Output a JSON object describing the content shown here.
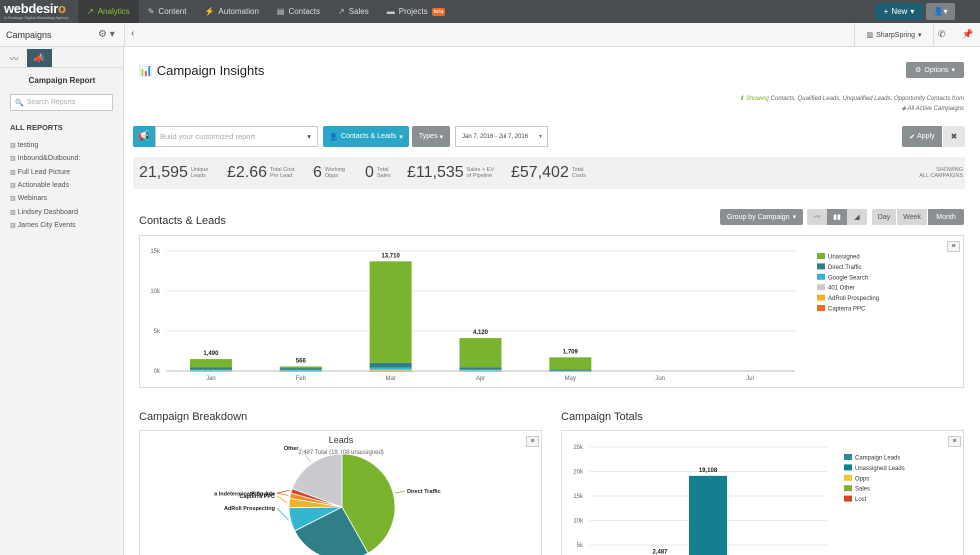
{
  "brand": {
    "name_a": "webdesir",
    "name_b": "o",
    "tagline": "A Strategic Digital Marketing Agency"
  },
  "nav": [
    {
      "label": "Analytics",
      "icon": "chart-line-icon",
      "glyph": "↗",
      "active": true
    },
    {
      "label": "Content",
      "icon": "pencil-icon",
      "glyph": "✎",
      "active": false
    },
    {
      "label": "Automation",
      "icon": "wand-icon",
      "glyph": "⚡",
      "active": false
    },
    {
      "label": "Contacts",
      "icon": "contacts-icon",
      "glyph": "▤",
      "active": false
    },
    {
      "label": "Sales",
      "icon": "sales-icon",
      "glyph": "↗",
      "active": false
    },
    {
      "label": "Projects",
      "icon": "folder-icon",
      "glyph": "▬",
      "active": false,
      "badge": "beta"
    }
  ],
  "top_right": {
    "new_label": "New",
    "user_icon": "user-icon"
  },
  "subbar": {
    "campaigns": "Campaigns",
    "account": "SharpSpring"
  },
  "sidebar": {
    "title": "Campaign Report",
    "search_placeholder": "Search Reports",
    "section": "ALL REPORTS",
    "items": [
      "testing",
      "Inbound&Outbound:",
      "Full Lead Picture",
      "Actionable leads",
      "Webinars",
      "Lindsey Dashboard",
      "James City Events"
    ]
  },
  "header": {
    "title": "Campaign Insights",
    "options_label": "Options",
    "showing_prefix": "Showing",
    "showing_text": "Contacts, Qualified Leads, Unqualified Leads, Opportunity Contacts from",
    "showing_scope": "All Active Campaigns"
  },
  "toolbar": {
    "report_placeholder": "Build your customized report",
    "contacts_label": "Contacts & Leads",
    "types_label": "Types",
    "date_range": "Jan 7, 2016 - Jul 7, 2016",
    "apply_label": "Apply"
  },
  "stats": [
    {
      "value": "21,595",
      "label1": "Unique",
      "label2": "Leads"
    },
    {
      "value": "£2.66",
      "label1": "Total Cost",
      "label2": "Per Lead"
    },
    {
      "value": "6",
      "label1": "Working",
      "label2": "Opps"
    },
    {
      "value": "0",
      "label1": "Total",
      "label2": "Sales"
    },
    {
      "value": "£11,535",
      "label1": "Sales + EV",
      "label2": "of Pipeline"
    },
    {
      "value": "£57,402",
      "label1": "Total",
      "label2": "Costs"
    }
  ],
  "stats_showing": {
    "line1": "SHOWING",
    "line2": "ALL CAMPAIGNS"
  },
  "contacts_section": {
    "title": "Contacts & Leads",
    "group_label": "Group by Campaign",
    "periods": [
      "Day",
      "Week",
      "Month"
    ],
    "active_period": "Month"
  },
  "breakdown_title": "Campaign Breakdown",
  "totals_title": "Campaign Totals",
  "colors": {
    "unassigned": "#7ab32e",
    "direct": "#2e7f87",
    "google": "#35b6d0",
    "other401": "#c9cbce",
    "adroll": "#f0b323",
    "capterra": "#ee6c23",
    "bing": "#d9452b",
    "indeterminate": "#f08b2a",
    "campaign_leads": "#2f8a8a",
    "unassigned_leads": "#14808f",
    "opps": "#f0c431",
    "sales": "#7ab32e",
    "lost": "#d9452b"
  },
  "chart_data": [
    {
      "type": "bar",
      "stacked": true,
      "categories": [
        "Jan",
        "Feb",
        "Mar",
        "Apr",
        "May",
        "Jun",
        "Jul"
      ],
      "totals": [
        1490,
        566,
        13710,
        4120,
        1709,
        null,
        null
      ],
      "total_labels": [
        "1,490",
        "566",
        "13,710",
        "4,120",
        "1,709",
        "",
        ""
      ],
      "series": [
        {
          "name": "Unassigned",
          "color": "#7ab32e",
          "values": [
            1050,
            200,
            12700,
            3650,
            1500,
            0,
            0
          ]
        },
        {
          "name": "Direct Traffic",
          "color": "#2e7f87",
          "values": [
            280,
            220,
            600,
            300,
            140,
            0,
            0
          ]
        },
        {
          "name": "Google Search",
          "color": "#35b6d0",
          "values": [
            80,
            80,
            250,
            90,
            40,
            0,
            0
          ]
        },
        {
          "name": "401 Other",
          "color": "#c9cbce",
          "values": [
            50,
            50,
            120,
            50,
            20,
            0,
            0
          ]
        },
        {
          "name": "AdRoll Prospecting",
          "color": "#f0b323",
          "values": [
            20,
            10,
            30,
            20,
            5,
            0,
            0
          ]
        },
        {
          "name": "Capterra PPC",
          "color": "#ee6c23",
          "values": [
            10,
            6,
            10,
            10,
            4,
            0,
            0
          ]
        }
      ],
      "y_ticks": [
        "0k",
        "5k",
        "10k",
        "15k"
      ],
      "ylim": [
        0,
        15000
      ],
      "legend": "right"
    },
    {
      "type": "pie",
      "title": "Leads",
      "subtitle": "2,487 Total (19,108 unassigned)",
      "slices": [
        {
          "name": "Direct Traffic",
          "value": 1040,
          "color": "#7ab32e"
        },
        {
          "name": "",
          "value": 640,
          "color": "#2e7f87"
        },
        {
          "name": "AdRoll Prospecting",
          "value": 180,
          "color": "#35b6d0"
        },
        {
          "name": "Capterra PPC",
          "value": 70,
          "color": "#f0b323"
        },
        {
          "name": "a Indeterminate Source",
          "value": 40,
          "color": "#f08b2a"
        },
        {
          "name": "Bing Ads",
          "value": 35,
          "color": "#d9452b"
        },
        {
          "name": "Other",
          "value": 482,
          "color": "#c9cbce"
        }
      ]
    },
    {
      "type": "bar",
      "bars": [
        {
          "name": "Campaign Leads",
          "value": 2487,
          "label": "2,487",
          "color": "#2f8a8a"
        },
        {
          "name": "Unassigned Leads",
          "value": 19108,
          "label": "19,108",
          "color": "#14808f"
        }
      ],
      "legend_items": [
        {
          "name": "Campaign Leads",
          "color": "#2f8a8a"
        },
        {
          "name": "Unassigned Leads",
          "color": "#14808f"
        },
        {
          "name": "Opps",
          "color": "#f0c431"
        },
        {
          "name": "Sales",
          "color": "#7ab32e"
        },
        {
          "name": "Lost",
          "color": "#d9452b"
        }
      ],
      "y_ticks": [
        "5k",
        "10k",
        "15k",
        "20k",
        "25k"
      ],
      "ylim": [
        0,
        25000
      ],
      "legend": "right"
    }
  ]
}
